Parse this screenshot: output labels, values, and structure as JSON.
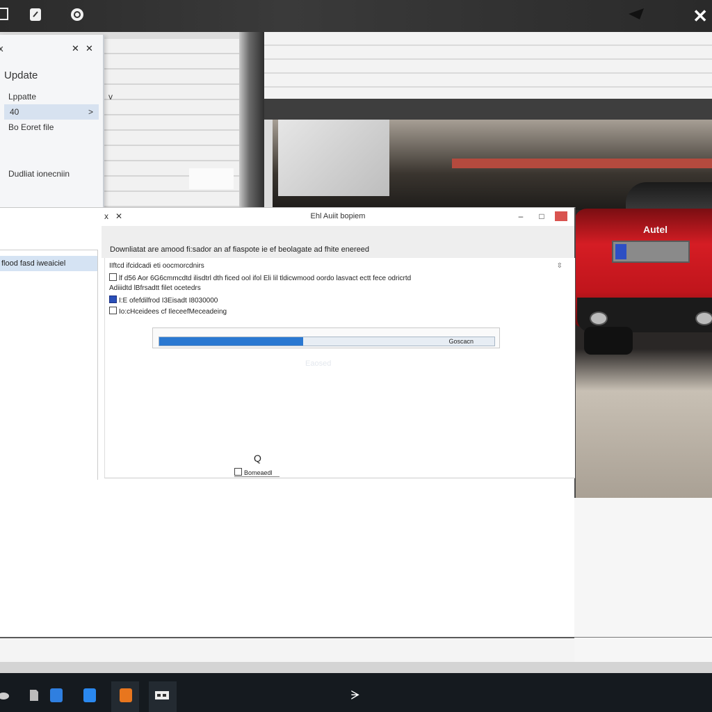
{
  "top_bar": {
    "icons": [
      "document-icon",
      "clipboard-icon",
      "refresh-icon",
      "navigation-icon"
    ],
    "close_glyph": "✕"
  },
  "scene": {
    "car_brand": "Autel",
    "car_color": "#d51d24"
  },
  "left_panel": {
    "close_glyph_1": "x",
    "close_glyph_2": "✕",
    "close_glyph_3": "✕",
    "title": "Update",
    "items": [
      {
        "label": "Lppatte",
        "chevron": "v"
      },
      {
        "label": "40",
        "chevron": ">"
      },
      {
        "label": "Bo Eoret file"
      }
    ],
    "note": "Dudliat ionecniin"
  },
  "main_window": {
    "title_x1": "x",
    "title_x2": "✕",
    "title": "Ehl Auiit bopiem",
    "min_glyph": "‒",
    "max_glyph": "□",
    "header_text": "Downliatat are amood fi:sador an af fiaspote ie ef beolagate ad fhite enereed",
    "sidebar_item": "flood fasd iweaiciel",
    "lines": [
      {
        "checkbox": false,
        "text": "IIftcd ifcidcadi eti oocmorcdnirs"
      },
      {
        "checkbox": "empty",
        "text": "lf d56 Aor 6G6cmmcdtd ilisdtrl dth ficed ool ifol Eli lil tldicwmood oordo lasvact ectt fece odricrtd"
      },
      {
        "checkbox": false,
        "text": "Adiiidtd lBfrsadtt filet ocetedrs"
      },
      {
        "checkbox": "checked",
        "text": "I:E ofefdilfrod I3Eisadt I8030000"
      },
      {
        "checkbox": "empty",
        "text": "Io:cHceidees cf IleceefMeceadeing"
      }
    ],
    "scroll_glyph": "⇳",
    "progress": {
      "fraction": 0.43,
      "label": "Goscacn",
      "fill_color": "#2a78d1"
    },
    "ghost_text": "Eaosed",
    "number": "Q",
    "cancel_label": "Bomeaedl"
  },
  "taskbar": {
    "icons": [
      "cloud-icon",
      "file-icon",
      "word-icon",
      "folder-icon",
      "app-orange-icon",
      "settings-icon",
      "play-icon"
    ],
    "center_glyph": "ᗒ"
  }
}
